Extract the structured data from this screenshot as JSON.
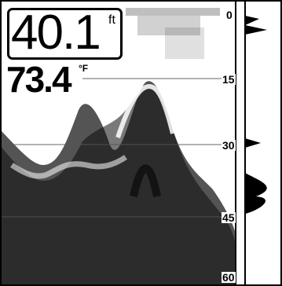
{
  "readout": {
    "depth_value": "40.1",
    "depth_unit": "ft",
    "temperature_value": "73.4",
    "temperature_unit": "°F"
  },
  "depth_scale": {
    "labels": [
      "0",
      "15",
      "30",
      "45",
      "60"
    ],
    "min": 0,
    "max": 60
  },
  "colors": {
    "background": "#ffffff",
    "sonar_returns": "#000000",
    "grid_lines": "#555555"
  }
}
